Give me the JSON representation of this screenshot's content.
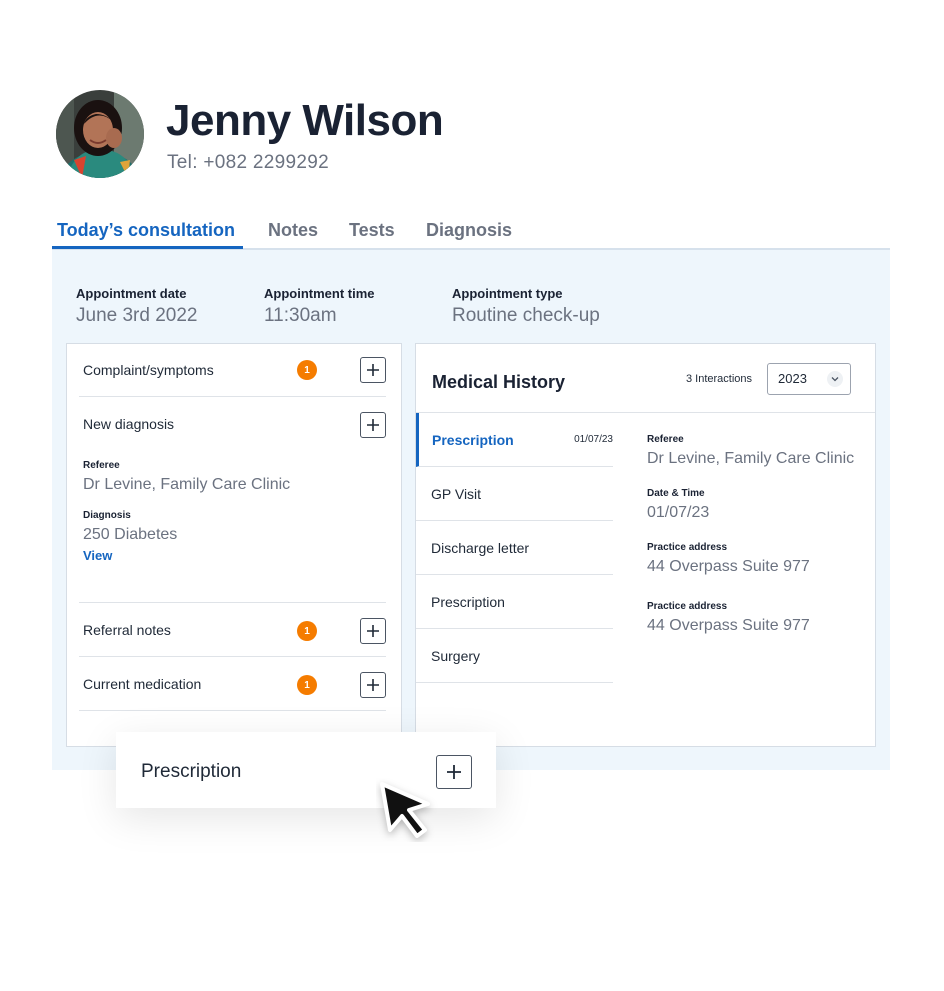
{
  "patient": {
    "name": "Jenny Wilson",
    "tel": "Tel: +082 2299292"
  },
  "tabs": [
    {
      "label": "Today’s consultation",
      "active": true
    },
    {
      "label": "Notes",
      "active": false
    },
    {
      "label": "Tests",
      "active": false
    },
    {
      "label": "Diagnosis",
      "active": false
    }
  ],
  "appointment": {
    "date_label": "Appointment date",
    "date_value": "June 3rd 2022",
    "time_label": "Appointment time",
    "time_value": "11:30am",
    "type_label": "Appointment type",
    "type_value": "Routine check-up"
  },
  "left_panel": {
    "complaint": {
      "label": "Complaint/symptoms",
      "badge": "1"
    },
    "new_diagnosis": {
      "label": "New diagnosis",
      "referee_label": "Referee",
      "referee_value": "Dr Levine, Family Care Clinic",
      "diagnosis_label": "Diagnosis",
      "diagnosis_value": "250 Diabetes",
      "view_link": "View"
    },
    "referral_notes": {
      "label": "Referral notes",
      "badge": "1"
    },
    "current_medication": {
      "label": "Current medication",
      "badge": "1"
    }
  },
  "medical_history": {
    "title": "Medical History",
    "interactions": "3 Interactions",
    "year": "2023",
    "items": [
      {
        "label": "Prescription",
        "date": "01/07/23",
        "active": true
      },
      {
        "label": "GP Visit"
      },
      {
        "label": "Discharge letter"
      },
      {
        "label": "Prescription"
      },
      {
        "label": "Surgery"
      }
    ],
    "details": {
      "referee_label": "Referee",
      "referee_value": "Dr Levine, Family Care Clinic",
      "datetime_label": "Date & Time",
      "datetime_value": "01/07/23",
      "address_label_1": "Practice address",
      "address_value_1": "44 Overpass Suite 977",
      "address_label_2": "Practice address",
      "address_value_2": "44 Overpass Suite 977"
    }
  },
  "floating": {
    "label": "Prescription"
  },
  "colors": {
    "accent": "#1565c0",
    "badge": "#f57c00",
    "panel_bg": "#eef6fc",
    "title": "#1a2233",
    "muted": "#6b7280"
  },
  "icons": [
    "plus-icon",
    "chevron-down-icon",
    "mouse-pointer-icon",
    "avatar-photo"
  ]
}
